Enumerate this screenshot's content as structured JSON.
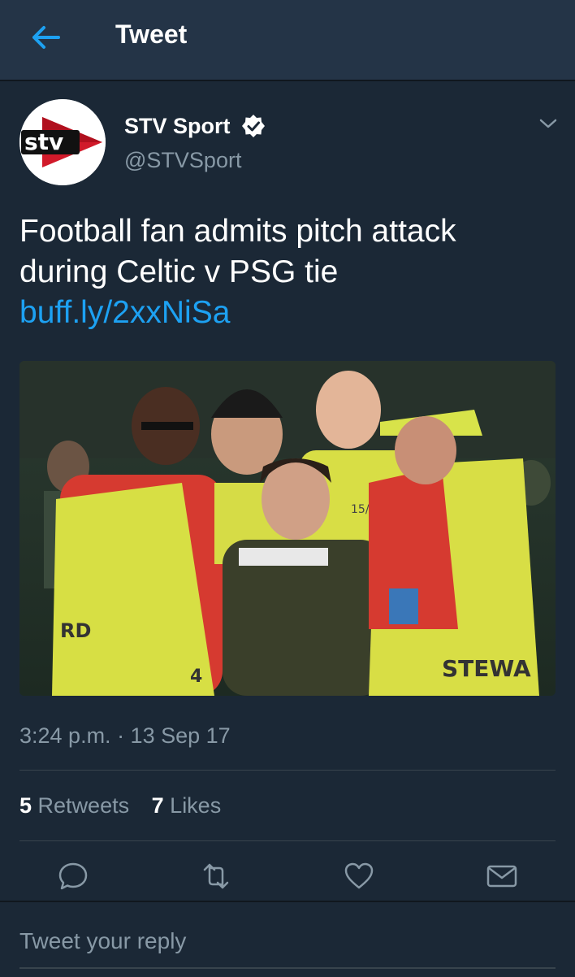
{
  "header": {
    "title": "Tweet",
    "back_icon": "back-arrow-icon"
  },
  "tweet": {
    "author": {
      "name": "STV Sport",
      "handle": "@STVSport",
      "verified": true,
      "avatar_logo_text": "stv"
    },
    "text": "Football fan admits pitch attack during Celtic v PSG tie ",
    "link": "buff.ly/2xxNiSa",
    "media": {
      "description_icon": "photo-image",
      "visible_text": [
        "15/18",
        "RD",
        "STEWA",
        "4"
      ]
    },
    "timestamp": "3:24 p.m. · 13 Sep 17",
    "stats": {
      "retweets_count": "5",
      "retweets_label": "Retweets",
      "likes_count": "7",
      "likes_label": "Likes"
    },
    "actions": [
      "reply-icon",
      "retweet-icon",
      "like-icon",
      "direct-message-icon"
    ]
  },
  "reply": {
    "placeholder": "Tweet your reply"
  },
  "colors": {
    "background": "#141d26",
    "header": "#243447",
    "card": "#1b2836",
    "accent": "#1da1f2",
    "secondary_text": "#8899a6",
    "divider": "#38444d"
  }
}
